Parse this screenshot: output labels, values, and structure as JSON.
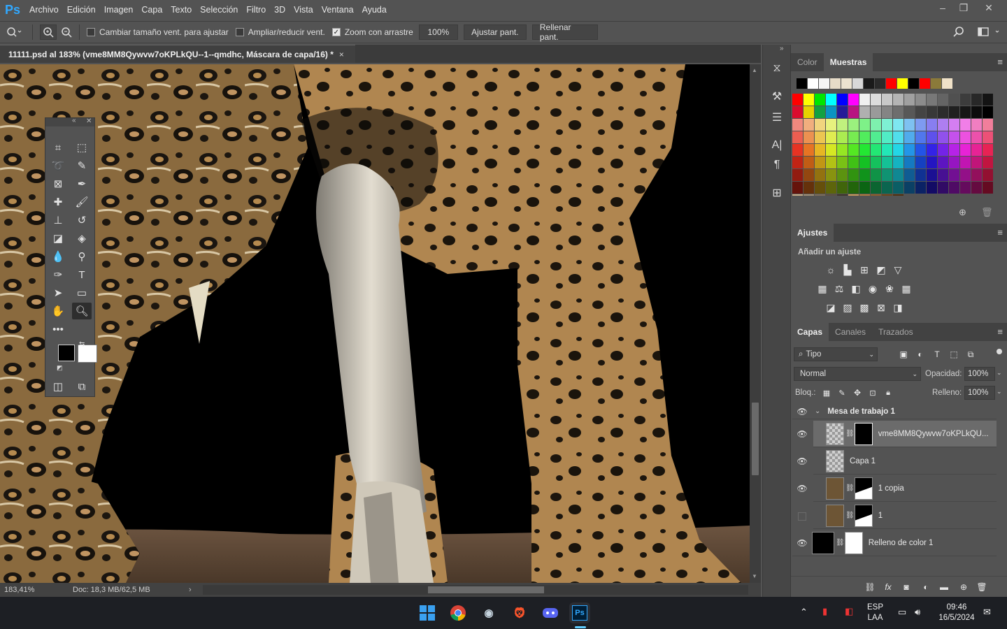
{
  "app": {
    "logo": "Ps"
  },
  "menu": [
    "Archivo",
    "Edición",
    "Imagen",
    "Capa",
    "Texto",
    "Selección",
    "Filtro",
    "3D",
    "Vista",
    "Ventana",
    "Ayuda"
  ],
  "options": {
    "resize_windows": "Cambiar tamaño vent. para ajustar",
    "zoom_all": "Ampliar/reducir vent.",
    "scrubby_zoom": "Zoom con arrastre",
    "zoom_value": "100%",
    "fit_screen": "Ajustar pant.",
    "fill_screen": "Rellenar pant."
  },
  "document": {
    "tab_title": "11111.psd al 183% (vme8MM8Qywvw7oKPLkQU--1--qmdhc, Máscara de capa/16) *",
    "close": "×"
  },
  "status": {
    "zoom": "183,41%",
    "doc": "Doc: 18,3 MB/62,5 MB"
  },
  "color_panel": {
    "tab_color": "Color",
    "tab_swatches": "Muestras"
  },
  "adjustments": {
    "title": "Ajustes",
    "subtitle": "Añadir un ajuste"
  },
  "layers_panel": {
    "tab_layers": "Capas",
    "tab_channels": "Canales",
    "tab_paths": "Trazados",
    "filter": "Tipo",
    "blend_mode": "Normal",
    "opacity_label": "Opacidad:",
    "opacity": "100%",
    "lock_label": "Bloq.:",
    "fill_label": "Relleno:",
    "fill": "100%",
    "group": "Mesa de trabajo 1",
    "layers": [
      {
        "name": "vme8MM8Qywvw7oKPLkQU..."
      },
      {
        "name": "Capa 1"
      },
      {
        "name": "1 copia"
      },
      {
        "name": "1"
      },
      {
        "name": "Relleno de color 1"
      }
    ]
  },
  "taskbar": {
    "lang1": "ESP",
    "lang2": "LAA",
    "time": "09:46",
    "date": "16/5/2024"
  },
  "colors": {
    "ps_blue": "#31a8ff",
    "panel": "#535353",
    "dark": "#424242"
  }
}
